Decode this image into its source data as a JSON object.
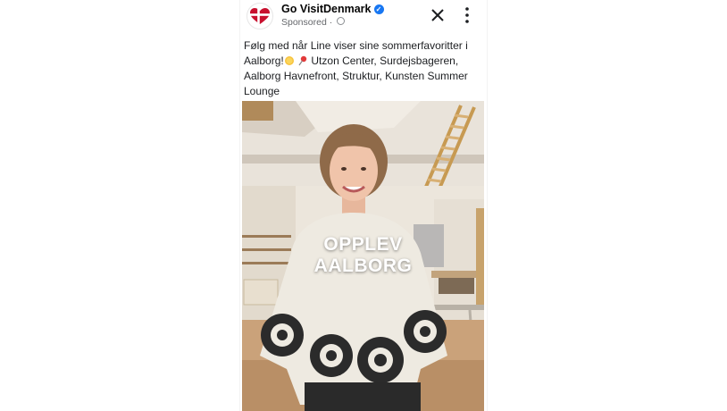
{
  "post": {
    "page_name": "Go VisitDenmark",
    "sponsored_label": "Sponsored",
    "separator": "·",
    "icons": {
      "avatar": "denmark-heart-logo",
      "verified": "verified-badge-icon",
      "audience": "globe-icon",
      "close": "close-icon",
      "more": "more-vertical-icon"
    },
    "caption": {
      "line_a": "Følg med når Line viser sine sommerfavoritter i Aalborg!",
      "line_b": "Utzon Center, Surdejsbageren, Aalborg Havnefront, Struktur, Kunsten Summer Lounge"
    },
    "video": {
      "overlay_line1": "OPPLEV",
      "overlay_line2": "AALBORG"
    }
  },
  "colors": {
    "brand_red": "#c8102e",
    "verified_blue": "#1877f2",
    "secondary_text": "#65676b"
  }
}
